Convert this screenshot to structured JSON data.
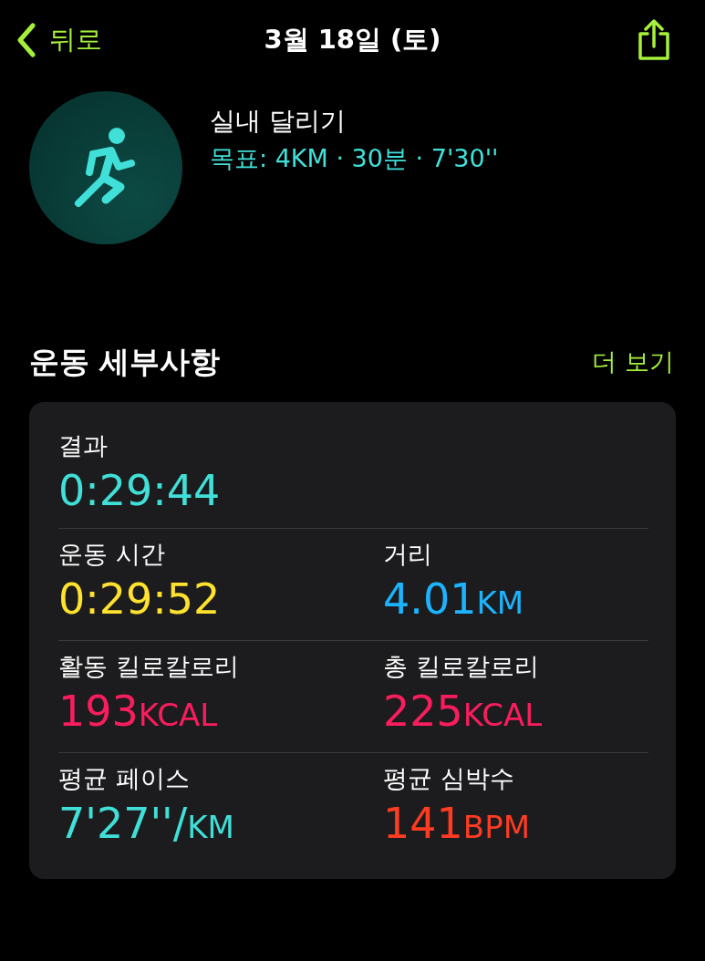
{
  "nav": {
    "back": "뒤로",
    "title": "3월 18일 (토)"
  },
  "workout": {
    "name": "실내 달리기",
    "goal": "목표: 4KM · 30분 · 7'30''"
  },
  "section": {
    "title": "운동 세부사항",
    "more": "더 보기"
  },
  "rows": [
    [
      {
        "label": "결과",
        "value": "0:29:44",
        "color": "#40e0d8"
      }
    ],
    [
      {
        "label": "운동 시간",
        "value": "0:29:52",
        "color": "#ffe22e"
      },
      {
        "label": "거리",
        "value": "4.01",
        "unit": "KM",
        "color": "#1cb4ff"
      }
    ],
    [
      {
        "label": "활동 킬로칼로리",
        "value": "193",
        "unit": "KCAL",
        "color": "#fa1d5e"
      },
      {
        "label": "총 킬로칼로리",
        "value": "225",
        "unit": "KCAL",
        "color": "#fa1d5e"
      }
    ],
    [
      {
        "label": "평균 페이스",
        "value": "7'27''/",
        "unit": "KM",
        "color": "#40e0d8"
      },
      {
        "label": "평균 심박수",
        "value": "141",
        "unit": "BPM",
        "color": "#ff3b22"
      }
    ]
  ]
}
